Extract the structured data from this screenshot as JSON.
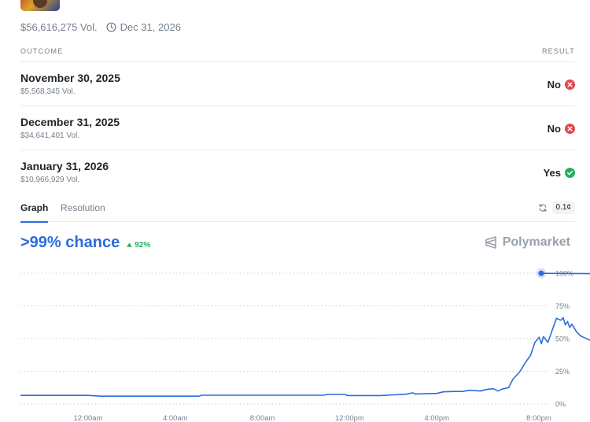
{
  "header": {
    "volume": "$56,616,275 Vol.",
    "end_date": "Dec 31, 2026",
    "icons": {
      "clock": "clock-icon"
    }
  },
  "table": {
    "outcome_header": "OUTCOME",
    "result_header": "RESULT",
    "rows": [
      {
        "name": "November 30, 2025",
        "volume": "$5,568,345 Vol.",
        "result": "No",
        "status": "no"
      },
      {
        "name": "December 31, 2025",
        "volume": "$34,641,401 Vol.",
        "result": "No",
        "status": "no"
      },
      {
        "name": "January 31, 2026",
        "volume": "$10,966,929 Vol.",
        "result": "Yes",
        "status": "yes"
      }
    ]
  },
  "tabs": {
    "graph": "Graph",
    "resolution": "Resolution",
    "denomination": "0.1¢"
  },
  "summary": {
    "chance": ">99% chance",
    "change": "92%"
  },
  "brand": {
    "name": "Polymarket"
  },
  "colors": {
    "accent": "#2d6cdf",
    "yes": "#27ae60",
    "no": "#e5484d"
  },
  "chart_data": {
    "type": "line",
    "x_ticks": [
      "12:00am",
      "4:00am",
      "8:00am",
      "12:00pm",
      "4:00pm",
      "8:00pm"
    ],
    "y_ticks": [
      "100%",
      "75%",
      "50%",
      "25%",
      "0%"
    ],
    "ylim": [
      0,
      100
    ],
    "grid": true,
    "series": [
      {
        "values": [
          [
            -3.1,
            6.5
          ],
          [
            0.0,
            6.5
          ],
          [
            0.6,
            5.9
          ],
          [
            2.2,
            5.9
          ],
          [
            4.0,
            5.9
          ],
          [
            5.1,
            5.9
          ],
          [
            5.2,
            6.6
          ],
          [
            8.0,
            6.6
          ],
          [
            10.8,
            6.6
          ],
          [
            11.0,
            7.2
          ],
          [
            11.8,
            7.2
          ],
          [
            11.9,
            6.4
          ],
          [
            13.4,
            6.4
          ],
          [
            14.0,
            6.9
          ],
          [
            14.6,
            7.4
          ],
          [
            14.9,
            8.5
          ],
          [
            15.0,
            7.6
          ],
          [
            16.0,
            8.0
          ],
          [
            16.3,
            9.2
          ],
          [
            16.8,
            9.5
          ],
          [
            17.2,
            9.5
          ],
          [
            17.5,
            10.4
          ],
          [
            17.8,
            10.1
          ],
          [
            18.0,
            9.8
          ],
          [
            18.2,
            10.7
          ],
          [
            18.4,
            11.3
          ],
          [
            18.6,
            11.6
          ],
          [
            18.8,
            9.8
          ],
          [
            19.0,
            11.3
          ],
          [
            19.3,
            12.5
          ],
          [
            19.5,
            19.0
          ],
          [
            19.8,
            24.4
          ],
          [
            20.1,
            32.5
          ],
          [
            20.3,
            37.0
          ],
          [
            20.5,
            47.0
          ],
          [
            20.7,
            51.0
          ],
          [
            20.8,
            46.0
          ],
          [
            20.9,
            51.5
          ],
          [
            21.1,
            47.0
          ],
          [
            21.3,
            56.5
          ],
          [
            21.5,
            65.5
          ],
          [
            21.7,
            64.0
          ],
          [
            21.8,
            66.0
          ],
          [
            21.9,
            60.5
          ],
          [
            22.0,
            63.0
          ],
          [
            22.1,
            58.5
          ],
          [
            22.2,
            61.0
          ],
          [
            22.4,
            55.5
          ],
          [
            22.6,
            52.0
          ],
          [
            22.8,
            50.5
          ],
          [
            23.0,
            49.0
          ],
          [
            23.2,
            47.5
          ],
          [
            23.4,
            46.0
          ],
          [
            23.5,
            44.5
          ],
          [
            23.6,
            45.5
          ],
          [
            23.7,
            44.8
          ],
          [
            23.8,
            43.5
          ],
          [
            24.0,
            42.0
          ],
          [
            24.1,
            44.0
          ],
          [
            24.2,
            42.5
          ],
          [
            24.3,
            41.5
          ],
          [
            24.5,
            40.5
          ],
          [
            24.8,
            39.0
          ],
          [
            25.2,
            37.5
          ],
          [
            25.5,
            37.0
          ],
          [
            25.7,
            38.0
          ],
          [
            25.75,
            50.0
          ],
          [
            25.85,
            85.0
          ],
          [
            26.0,
            99.4
          ],
          [
            28.2,
            99.6
          ],
          [
            29.6,
            99.8
          ],
          [
            30.5,
            99.9
          ]
        ]
      }
    ]
  }
}
